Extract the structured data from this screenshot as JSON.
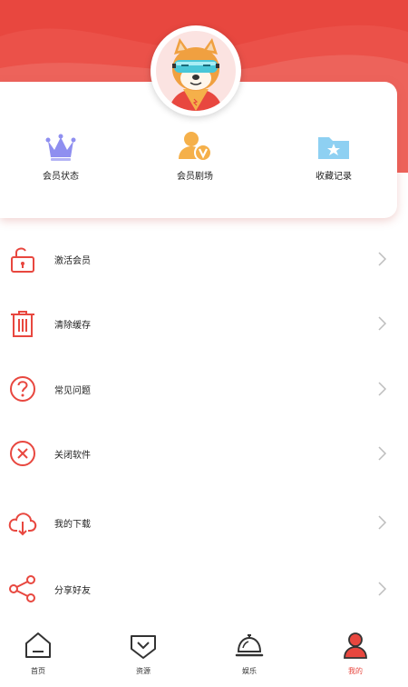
{
  "colors": {
    "accent": "#e8473f",
    "icon_red": "#e8473f",
    "crown": "#8f8ff0",
    "user_v": "#f5b04a",
    "folder": "#8ed0f2"
  },
  "quick_actions": [
    {
      "label": "会员状态",
      "icon": "crown-icon"
    },
    {
      "label": "会员剧场",
      "icon": "user-v-icon"
    },
    {
      "label": "收藏记录",
      "icon": "folder-star-icon"
    }
  ],
  "menu": [
    {
      "label": "激活会员",
      "icon": "lock-icon"
    },
    {
      "label": "清除缓存",
      "icon": "trash-icon"
    },
    {
      "label": "常见问题",
      "icon": "question-icon"
    },
    {
      "label": "关闭软件",
      "icon": "close-circle-icon"
    },
    {
      "label": "我的下载",
      "icon": "cloud-download-icon"
    },
    {
      "label": "分享好友",
      "icon": "share-icon"
    }
  ],
  "tabs": [
    {
      "label": "首页",
      "icon": "home-icon"
    },
    {
      "label": "资源",
      "icon": "resource-icon"
    },
    {
      "label": "娱乐",
      "icon": "bell-icon"
    },
    {
      "label": "我的",
      "icon": "user-icon",
      "active": true
    }
  ]
}
